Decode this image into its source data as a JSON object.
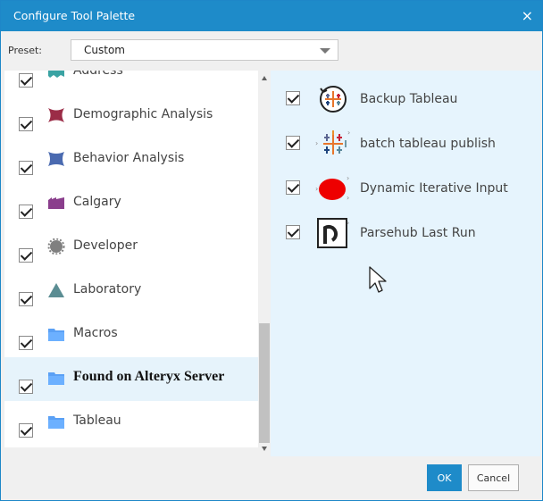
{
  "window": {
    "title": "Configure Tool Palette",
    "close_glyph": "×"
  },
  "preset": {
    "label": "Preset:",
    "value": "Custom"
  },
  "left_list": [
    {
      "label": "Address",
      "checked": true,
      "icon": "address-icon",
      "color": "#3aa3a3"
    },
    {
      "label": "Demographic Analysis",
      "checked": true,
      "icon": "demographic-analysis-icon",
      "color": "#9b2c47"
    },
    {
      "label": "Behavior Analysis",
      "checked": true,
      "icon": "behavior-analysis-icon",
      "color": "#4a6ab0"
    },
    {
      "label": "Calgary",
      "checked": true,
      "icon": "calgary-icon",
      "color": "#8a3e8c"
    },
    {
      "label": "Developer",
      "checked": true,
      "icon": "developer-icon",
      "color": "#808080"
    },
    {
      "label": "Laboratory",
      "checked": true,
      "icon": "laboratory-icon",
      "color": "#5b8d93"
    },
    {
      "label": "Macros",
      "checked": true,
      "icon": "folder-icon",
      "color": "#5aa0f5"
    },
    {
      "label": "Found on Alteryx Server",
      "checked": true,
      "icon": "folder-icon",
      "color": "#5aa0f5",
      "selected": true
    },
    {
      "label": "Tableau",
      "checked": true,
      "icon": "folder-icon",
      "color": "#5aa0f5"
    }
  ],
  "right_list": [
    {
      "label": "Backup Tableau",
      "checked": true,
      "icon": "backup-tableau-icon"
    },
    {
      "label": "batch tableau publish",
      "checked": true,
      "icon": "tableau-publish-icon"
    },
    {
      "label": "Dynamic Iterative Input",
      "checked": true,
      "icon": "red-blob-icon",
      "color": "#ee0000"
    },
    {
      "label": "Parsehub Last Run",
      "checked": true,
      "icon": "parsehub-icon"
    }
  ],
  "buttons": {
    "ok": "OK",
    "cancel": "Cancel"
  },
  "colors": {
    "accent": "#1e8bc9",
    "selection": "#e6f3fb",
    "right_panel": "#e6f4fd"
  }
}
